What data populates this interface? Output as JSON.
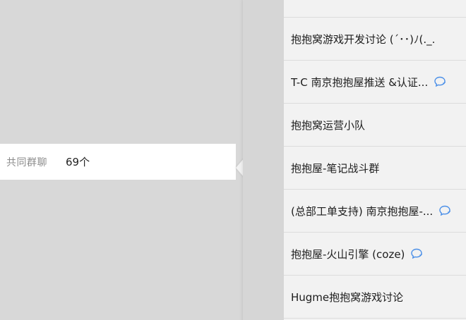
{
  "profile": {
    "common_groups_label": "共同群聊",
    "common_groups_count": "69个"
  },
  "groups": [
    {
      "name": "抱抱窝游戏开发讨论 (´･･)ﾉ(._.",
      "has_chat_icon": false
    },
    {
      "name": "T-C 南京抱抱屋推送 &认证...",
      "has_chat_icon": true
    },
    {
      "name": "抱抱窝运营小队",
      "has_chat_icon": false
    },
    {
      "name": "抱抱屋-笔记战斗群",
      "has_chat_icon": false
    },
    {
      "name": "(总部工单支持) 南京抱抱屋-...",
      "has_chat_icon": true
    },
    {
      "name": "抱抱屋-火山引擎 (coze)",
      "has_chat_icon": true
    },
    {
      "name": "Hugme抱抱窝游戏讨论",
      "has_chat_icon": false
    }
  ],
  "colors": {
    "chat_icon": "#4a8fe8",
    "background": "#d8d8d8",
    "popover": "#f2f2f2"
  }
}
